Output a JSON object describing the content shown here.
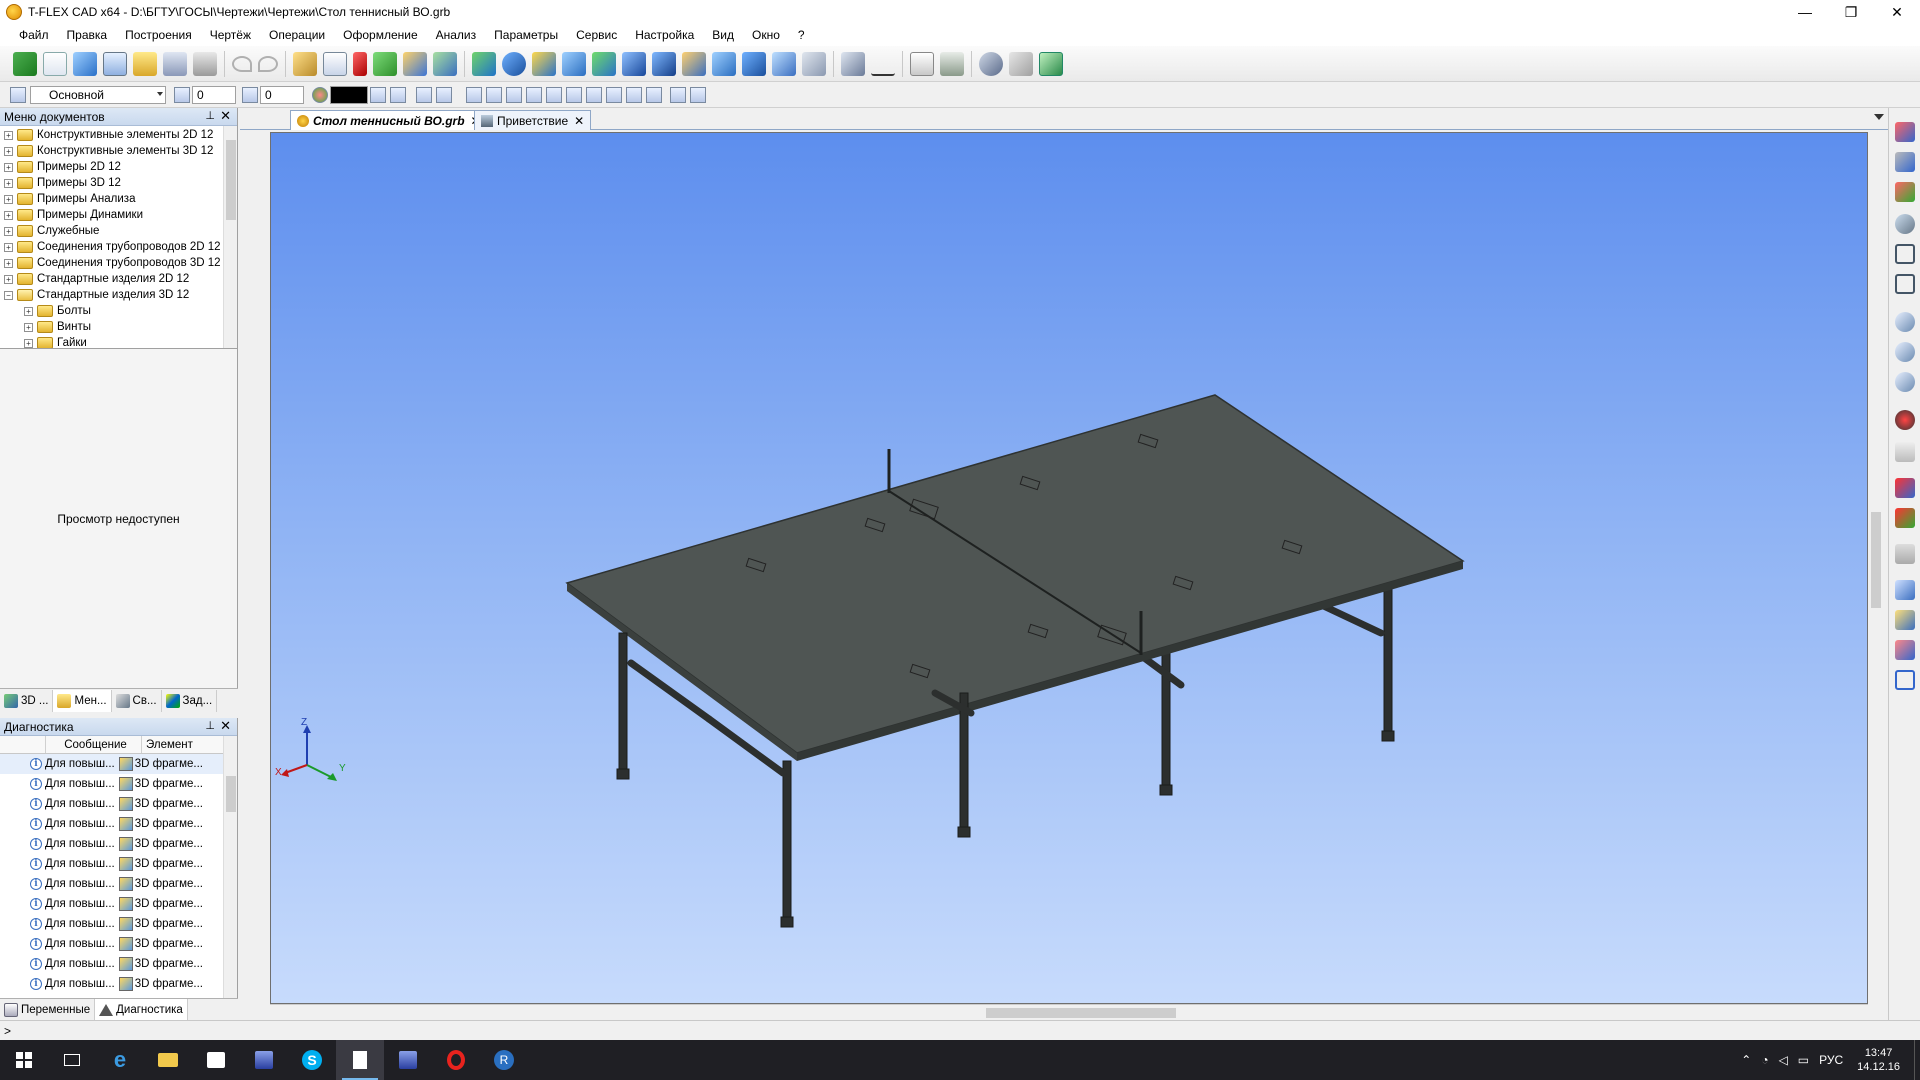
{
  "window": {
    "title": "T-FLEX CAD x64 - D:\\БГТУ\\ГОСЫ\\Чертежи\\Чертежи\\Стол теннисный ВО.grb",
    "minimize": "—",
    "restore": "❐",
    "close": "✕"
  },
  "menu": [
    "Файл",
    "Правка",
    "Построения",
    "Чертёж",
    "Операции",
    "Оформление",
    "Анализ",
    "Параметры",
    "Сервис",
    "Настройка",
    "Вид",
    "Окно",
    "?"
  ],
  "toolbar2": {
    "layer_value": "Основной",
    "level_value": "0",
    "priority_value": "0"
  },
  "doc_menu": {
    "title": "Меню документов",
    "items": [
      {
        "label": "Конструктивные элементы 2D 12",
        "indent": 0,
        "sign": "+"
      },
      {
        "label": "Конструктивные элементы 3D 12",
        "indent": 0,
        "sign": "+"
      },
      {
        "label": "Примеры 2D 12",
        "indent": 0,
        "sign": "+"
      },
      {
        "label": "Примеры 3D 12",
        "indent": 0,
        "sign": "+"
      },
      {
        "label": "Примеры Анализа",
        "indent": 0,
        "sign": "+"
      },
      {
        "label": "Примеры Динамики",
        "indent": 0,
        "sign": "+"
      },
      {
        "label": "Служебные",
        "indent": 0,
        "sign": "+"
      },
      {
        "label": "Соединения трубопроводов 2D 12",
        "indent": 0,
        "sign": "+"
      },
      {
        "label": "Соединения трубопроводов 3D 12",
        "indent": 0,
        "sign": "+"
      },
      {
        "label": "Стандартные изделия 2D 12",
        "indent": 0,
        "sign": "+"
      },
      {
        "label": "Стандартные изделия 3D 12",
        "indent": 0,
        "sign": "−"
      },
      {
        "label": "Болты",
        "indent": 1,
        "sign": "+"
      },
      {
        "label": "Винты",
        "indent": 1,
        "sign": "+"
      },
      {
        "label": "Гайки",
        "indent": 1,
        "sign": "+"
      }
    ]
  },
  "preview": {
    "text": "Просмотр недоступен"
  },
  "panel_tabs": [
    "3D ...",
    "Мен...",
    "Св...",
    "Зад..."
  ],
  "diagnostics": {
    "title": "Диагностика",
    "columns": [
      "Сообщение",
      "Элемент"
    ],
    "rows": [
      {
        "message": "Для повыш...",
        "element": "3D фрагме..."
      },
      {
        "message": "Для повыш...",
        "element": "3D фрагме..."
      },
      {
        "message": "Для повыш...",
        "element": "3D фрагме..."
      },
      {
        "message": "Для повыш...",
        "element": "3D фрагме..."
      },
      {
        "message": "Для повыш...",
        "element": "3D фрагме..."
      },
      {
        "message": "Для повыш...",
        "element": "3D фрагме..."
      },
      {
        "message": "Для повыш...",
        "element": "3D фрагме..."
      },
      {
        "message": "Для повыш...",
        "element": "3D фрагме..."
      },
      {
        "message": "Для повыш...",
        "element": "3D фрагме..."
      },
      {
        "message": "Для повыш...",
        "element": "3D фрагме..."
      },
      {
        "message": "Для повыш...",
        "element": "3D фрагме..."
      },
      {
        "message": "Для повыш...",
        "element": "3D фрагме..."
      }
    ]
  },
  "bottom_tabs": [
    "Переменные",
    "Диагностика"
  ],
  "doc_tabs": [
    {
      "label": "Стол теннисный ВО.grb",
      "active": true
    },
    {
      "label": "Приветствие",
      "active": false
    }
  ],
  "axes": {
    "x": "X",
    "y": "Y",
    "z": "Z"
  },
  "status": {
    "prompt": ">"
  },
  "tray": {
    "lang": "РУС",
    "time": "13:47",
    "date": "14.12.16"
  },
  "colors": {
    "viewport_top": "#5d8eee",
    "viewport_bottom": "#c7dbfc",
    "tabletop": "#4f5553",
    "legs": "#2c2f2e"
  }
}
